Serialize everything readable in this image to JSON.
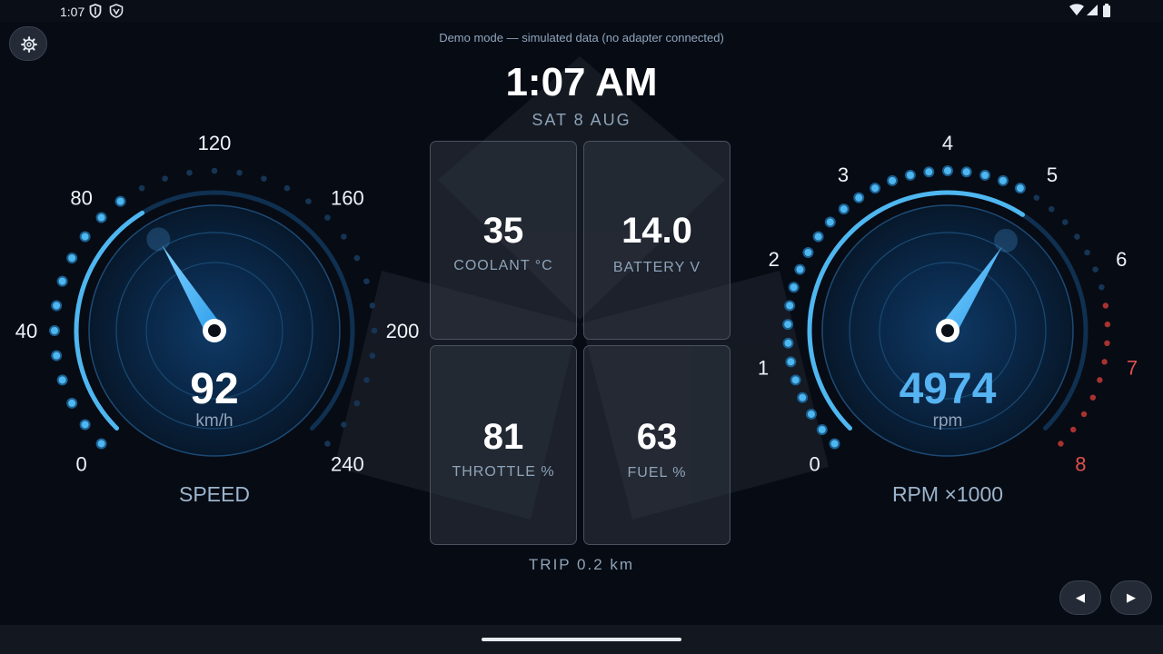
{
  "status_bar": {
    "time": "1:07",
    "icons": [
      "shield-icon",
      "vpn-icon",
      "wifi-icon",
      "signal-icon",
      "battery-icon"
    ]
  },
  "header": {
    "demo_text": "Demo mode — simulated data (no adapter connected)",
    "clock": "1:07 AM",
    "date": "SAT 8 AUG"
  },
  "speed_gauge": {
    "label": "SPEED",
    "value": 92,
    "value_text": "92",
    "unit": "km/h",
    "max": 240,
    "ticks": [
      "0",
      "40",
      "80",
      "120",
      "160",
      "200",
      "240"
    ],
    "accent": "#4fb7f0"
  },
  "rpm_gauge": {
    "label": "RPM ×1000",
    "value": 4974,
    "value_text": "4974",
    "unit": "rpm",
    "max": 8000,
    "redline": 7,
    "ticks": [
      "0",
      "1",
      "2",
      "3",
      "4",
      "5",
      "6",
      "7",
      "8"
    ],
    "accent": "#4fb7f0",
    "red": "#e0504c"
  },
  "tiles": [
    {
      "value": "35",
      "label": "COOLANT °C"
    },
    {
      "value": "14.0",
      "label": "BATTERY V"
    },
    {
      "value": "81",
      "label": "THROTTLE %"
    },
    {
      "value": "63",
      "label": "FUEL %"
    }
  ],
  "trip": "TRIP 0.2 km",
  "controls": {
    "settings_icon": "gear-icon",
    "prev_label": "◀",
    "next_label": "▶"
  }
}
